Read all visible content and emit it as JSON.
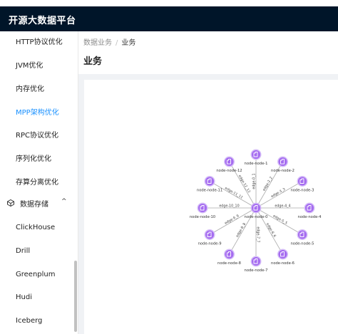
{
  "header": {
    "title": "开源大数据平台"
  },
  "sidebar": {
    "items": [
      {
        "label": "HTTP协议优化",
        "active": false
      },
      {
        "label": "JVM优化",
        "active": false
      },
      {
        "label": "内存优化",
        "active": false
      },
      {
        "label": "MPP架构优化",
        "active": true
      },
      {
        "label": "RPC协议优化",
        "active": false
      },
      {
        "label": "序列化优化",
        "active": false
      },
      {
        "label": "存算分离优化",
        "active": false
      }
    ],
    "group": {
      "label": "数据存储",
      "icon": "storage-icon",
      "expanded": true
    },
    "sub_items": [
      {
        "label": "ClickHouse"
      },
      {
        "label": "Drill"
      },
      {
        "label": "Greenplum"
      },
      {
        "label": "Hudi"
      },
      {
        "label": "Iceberg"
      }
    ]
  },
  "breadcrumb": {
    "parent": "数据业务",
    "separator": "/",
    "current": "业务"
  },
  "page": {
    "title": "业务"
  },
  "graph": {
    "center": {
      "label": "node-node-0"
    },
    "nodes": [
      {
        "label": "node-node-1",
        "edge": "edge-0_1"
      },
      {
        "label": "node-node-2",
        "edge": "edge-2_2"
      },
      {
        "label": "node-node-3",
        "edge": "edge-3_3"
      },
      {
        "label": "node-node-4",
        "edge": "edge-4_4"
      },
      {
        "label": "node-node-5",
        "edge": "edge-5_5"
      },
      {
        "label": "node-node-6",
        "edge": "edge-6_6"
      },
      {
        "label": "node-node-7",
        "edge": "edge-7_7"
      },
      {
        "label": "node-node-8",
        "edge": "edge-8_8"
      },
      {
        "label": "node-node-9",
        "edge": "edge-9_9"
      },
      {
        "label": "node-node-10",
        "edge": "edge-10_10"
      },
      {
        "label": "node-node-11",
        "edge": "edge-11_11"
      },
      {
        "label": "node-node-12",
        "edge": "edge-12_12"
      }
    ],
    "colors": {
      "node_fill": "#a56cf0",
      "node_ring": "#d6bff8",
      "edge": "#aaaaaa"
    }
  }
}
